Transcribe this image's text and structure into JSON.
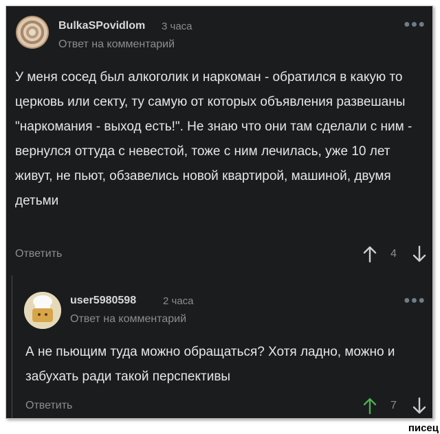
{
  "comment": {
    "username": "BulkaSPovidlom",
    "time": "3 часа",
    "reply_label": "Ответ на комментарий",
    "text": "У меня сосед был алкоголик и наркоман - обратился в какую то церковь или секту, ту самую от которых объявления развешаны \"наркомания - выход есть!\". Не знаю что они там сделали с ним - вернулся оттуда с невестой, тоже с ним лечилась, уже 10 лет живут, не пьют, обзавелись новой квартирой, машиной, двумя детьми",
    "reply_button": "Ответить",
    "score": "4"
  },
  "reply": {
    "username": "user5980598",
    "time": "2 часа",
    "reply_label": "Ответ на комментарий",
    "text": "А не пьющим туда можно обращаться? Хотя ладно, можно и забухать ради такой перспективы",
    "reply_button": "Ответить",
    "score": "7"
  },
  "watermark": "писец",
  "colors": {
    "background": "#1b1c1e",
    "upvote_active": "#4caf50"
  }
}
